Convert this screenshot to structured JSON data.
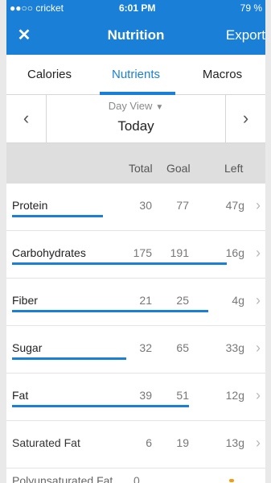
{
  "status": {
    "carrier": "●●○○ cricket",
    "time": "6:01 PM",
    "battery": "79 %"
  },
  "nav": {
    "title": "Nutrition",
    "export_label": "Export",
    "close_icon": "close-icon",
    "accent": "#1a7fd6"
  },
  "tabs": [
    {
      "label": "Calories",
      "active": false
    },
    {
      "label": "Nutrients",
      "active": true
    },
    {
      "label": "Macros",
      "active": false
    }
  ],
  "date_nav": {
    "view_label": "Day View",
    "date_label": "Today"
  },
  "columns": {
    "total": "Total",
    "goal": "Goal",
    "left": "Left"
  },
  "nutrients": [
    {
      "name": "Protein",
      "total": "30",
      "goal": "77",
      "left": "47g",
      "progress": 0.39
    },
    {
      "name": "Carbohydrates",
      "total": "175",
      "goal": "191",
      "left": "16g",
      "progress": 0.92
    },
    {
      "name": "Fiber",
      "total": "21",
      "goal": "25",
      "left": "4g",
      "progress": 0.84
    },
    {
      "name": "Sugar",
      "total": "32",
      "goal": "65",
      "left": "33g",
      "progress": 0.49
    },
    {
      "name": "Fat",
      "total": "39",
      "goal": "51",
      "left": "12g",
      "progress": 0.76
    },
    {
      "name": "Saturated Fat",
      "total": "6",
      "goal": "19",
      "left": "13g",
      "progress": 0.0
    }
  ],
  "partial_row": {
    "name": "Polyunsaturated Fat",
    "total": "0"
  }
}
